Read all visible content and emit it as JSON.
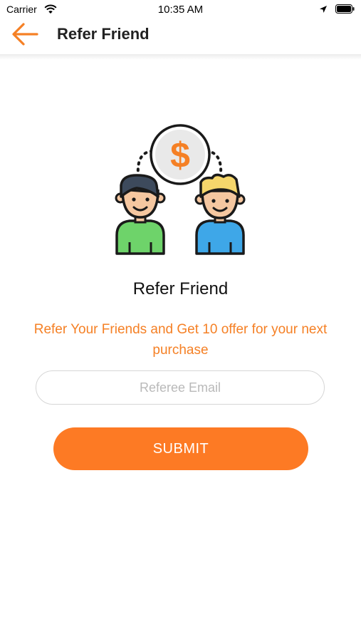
{
  "status_bar": {
    "carrier": "Carrier",
    "time": "10:35 AM"
  },
  "header": {
    "title": "Refer Friend",
    "back_icon": "arrow-left-icon",
    "accent_color": "#f58025"
  },
  "main": {
    "illustration_icon": "refer-friends-illustration",
    "title": "Refer Friend",
    "description": "Refer Your Friends and Get 10 offer for your next purchase",
    "email_placeholder": "Referee Email",
    "email_value": "",
    "submit_label": "SUBMIT",
    "submit_color": "#fd7a24"
  }
}
